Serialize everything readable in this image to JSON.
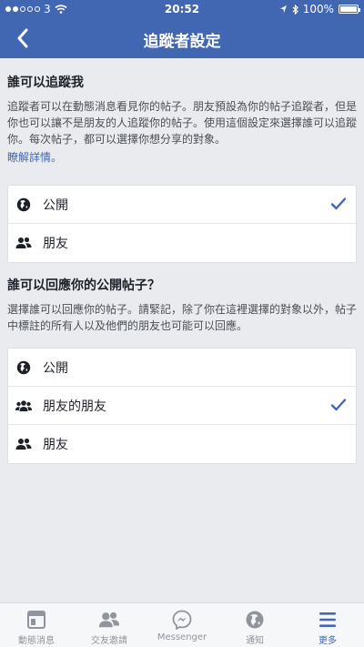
{
  "status_bar": {
    "carrier": "3",
    "time": "20:52",
    "battery": "100%"
  },
  "nav": {
    "title": "追蹤者設定"
  },
  "followers_section": {
    "title": "誰可以追蹤我",
    "description": "追蹤者可以在動態消息看見你的帖子。朋友預設為你的帖子追蹤者，但是你也可以讓不是朋友的人追蹤你的帖子。使用這個設定來選擇誰可以追蹤你。每次帖子，都可以選擇你想分享的對象。",
    "learn_more": "瞭解詳情。",
    "options": [
      {
        "label": "公開",
        "icon": "globe-icon",
        "selected": true
      },
      {
        "label": "朋友",
        "icon": "friends-icon",
        "selected": false
      }
    ]
  },
  "comments_section": {
    "title": "誰可以回應你的公開帖子？",
    "description": "選擇誰可以回應你的帖子。請緊記，除了你在這裡選擇的對象以外，帖子中標註的所有人以及他們的朋友也可能可以回應。",
    "options": [
      {
        "label": "公開",
        "icon": "globe-icon",
        "selected": false
      },
      {
        "label": "朋友的朋友",
        "icon": "friends-of-friends-icon",
        "selected": true
      },
      {
        "label": "朋友",
        "icon": "friends-icon",
        "selected": false
      }
    ]
  },
  "tabs": [
    {
      "label": "動態消息",
      "icon": "news-feed-icon",
      "active": false
    },
    {
      "label": "交友邀請",
      "icon": "friend-requests-icon",
      "active": false
    },
    {
      "label": "Messenger",
      "icon": "messenger-icon",
      "active": false
    },
    {
      "label": "通知",
      "icon": "notifications-icon",
      "active": false
    },
    {
      "label": "更多",
      "icon": "more-icon",
      "active": true
    }
  ],
  "colors": {
    "brand": "#4267b2",
    "background": "#e9ebee",
    "check": "#4267b2"
  }
}
